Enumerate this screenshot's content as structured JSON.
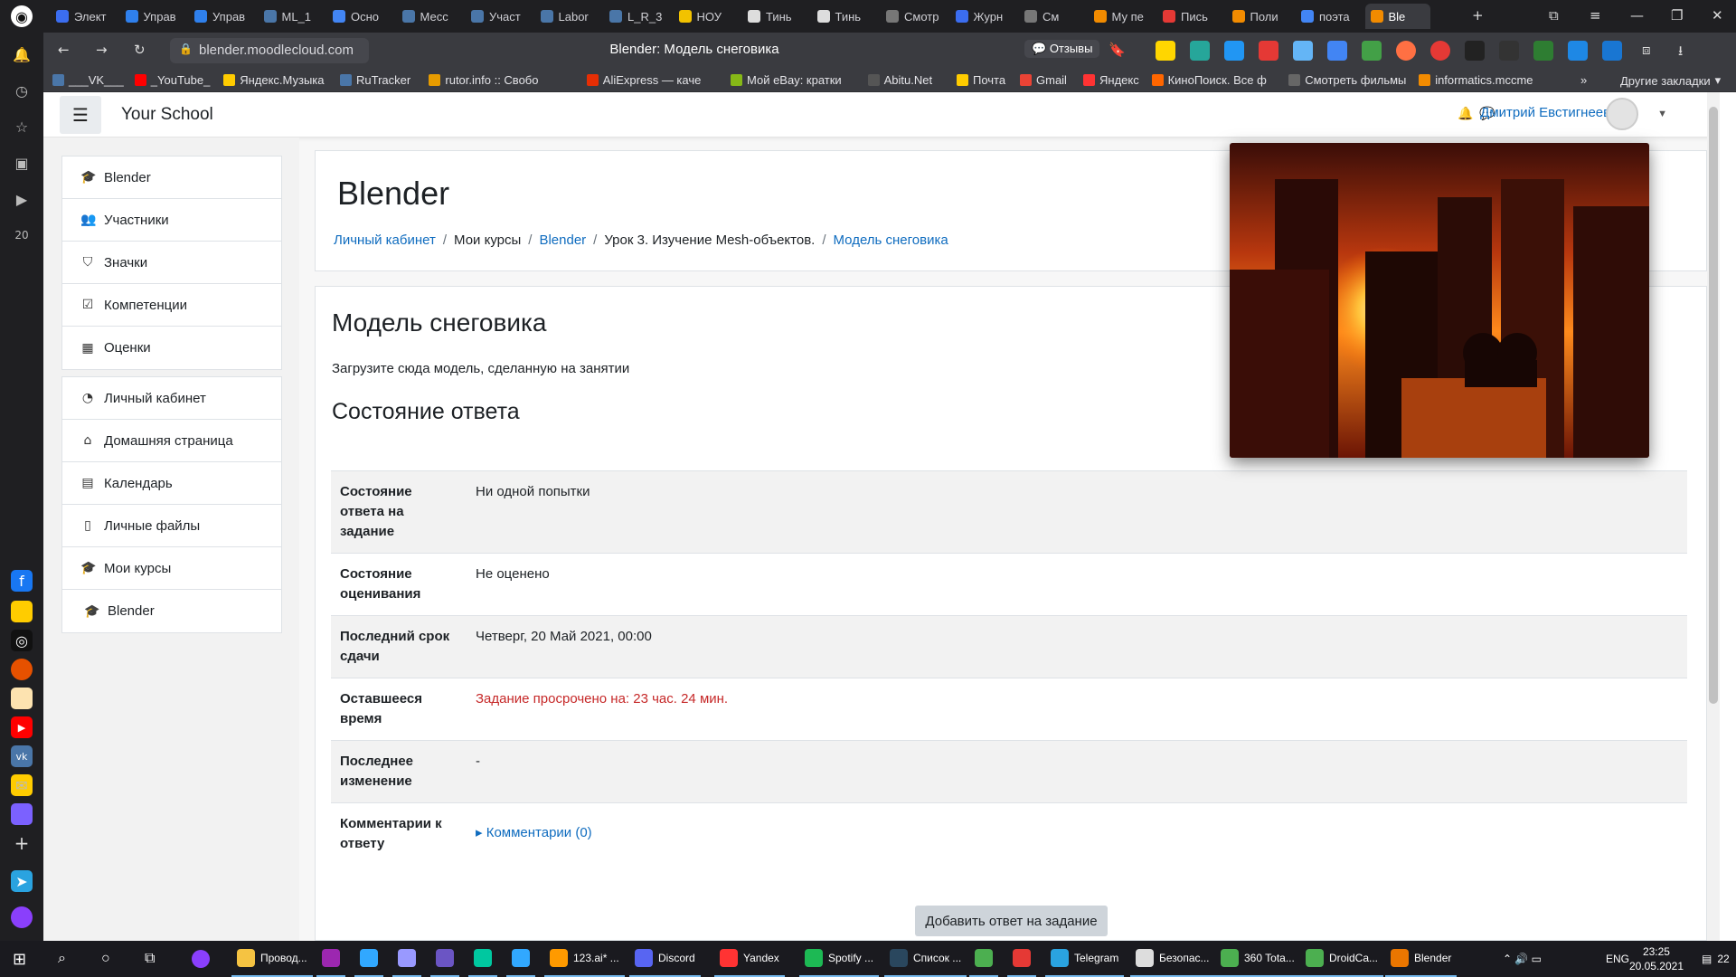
{
  "browser": {
    "tabs": [
      {
        "label": "Элект",
        "color": "#3b6df0"
      },
      {
        "label": "Управ",
        "color": "#2f80ed"
      },
      {
        "label": "Управ",
        "color": "#2f80ed"
      },
      {
        "label": "ML_1",
        "color": "#4a76a8"
      },
      {
        "label": "Осно",
        "color": "#4285f4"
      },
      {
        "label": "Месс",
        "color": "#4a76a8"
      },
      {
        "label": "Участ",
        "color": "#4a76a8"
      },
      {
        "label": "Labor",
        "color": "#4a76a8"
      },
      {
        "label": "L_R_3",
        "color": "#4a76a8"
      },
      {
        "label": "НОУ",
        "color": "#f2c200"
      },
      {
        "label": "Тинь",
        "color": "#dddddd"
      },
      {
        "label": "Тинь",
        "color": "#dddddd"
      },
      {
        "label": "Смотр",
        "color": "#777777"
      },
      {
        "label": "Журн",
        "color": "#3b6df0"
      },
      {
        "label": "См",
        "color": "#777777"
      },
      {
        "label": "Му пе",
        "color": "#f28b00"
      },
      {
        "label": "Пись",
        "color": "#e53935"
      },
      {
        "label": "Поли",
        "color": "#f28b00"
      },
      {
        "label": "поэта",
        "color": "#4285f4"
      },
      {
        "label": "Ble",
        "color": "#f28b00"
      }
    ],
    "url": "blender.moodlecloud.com",
    "page_title": "Blender: Модель снеговика",
    "feedback_label": "Отзывы",
    "bookmarks": [
      {
        "label": "___VK___",
        "color": "#4a76a8"
      },
      {
        "label": "_YouTube_",
        "color": "#ff0000"
      },
      {
        "label": "Яндекс.Музыка",
        "color": "#ffcc00"
      },
      {
        "label": "RuTracker",
        "color": "#4a76a8"
      },
      {
        "label": "rutor.info :: Свобо",
        "color": "#e69b00"
      },
      {
        "label": "AliExpress — каче",
        "color": "#e62e04"
      },
      {
        "label": "Мой eBay: кратки",
        "color": "#86b817"
      },
      {
        "label": "Abitu.Net",
        "color": "#555555"
      },
      {
        "label": "Почта",
        "color": "#ffcc00"
      },
      {
        "label": "Gmail",
        "color": "#ea4335"
      },
      {
        "label": "Яндекс",
        "color": "#ff3333"
      },
      {
        "label": "КиноПоиск. Все ф",
        "color": "#f60"
      },
      {
        "label": "Смотреть фильмы",
        "color": "#666666"
      },
      {
        "label": "informatics.mccme",
        "color": "#f28b00"
      }
    ],
    "other_bookmarks": "Другие закладки"
  },
  "moodle": {
    "site_name": "Your School",
    "user_name": "Дмитрий Евстигнеев",
    "drawer_group1": [
      {
        "label": "Blender",
        "icon": "graduation-cap-icon",
        "glyph": "🎓"
      },
      {
        "label": "Участники",
        "icon": "users-icon",
        "glyph": "👥"
      },
      {
        "label": "Значки",
        "icon": "shield-icon",
        "glyph": "⛉"
      },
      {
        "label": "Компетенции",
        "icon": "check-square-icon",
        "glyph": "☑"
      },
      {
        "label": "Оценки",
        "icon": "table-icon",
        "glyph": "▦"
      }
    ],
    "drawer_group2": [
      {
        "label": "Личный кабинет",
        "icon": "dashboard-icon",
        "glyph": "◔"
      },
      {
        "label": "Домашняя страница",
        "icon": "home-icon",
        "glyph": "⌂"
      },
      {
        "label": "Календарь",
        "icon": "calendar-icon",
        "glyph": "▤"
      },
      {
        "label": "Личные файлы",
        "icon": "file-icon",
        "glyph": "▯"
      },
      {
        "label": "Мои курсы",
        "icon": "graduation-cap-icon",
        "glyph": "🎓"
      },
      {
        "label": "Blender",
        "icon": "graduation-cap-icon",
        "glyph": "🎓"
      }
    ],
    "course_title": "Blender",
    "breadcrumbs": [
      {
        "label": "Личный кабинет",
        "link": true
      },
      {
        "label": "Мои курсы",
        "link": false
      },
      {
        "label": "Blender",
        "link": true
      },
      {
        "label": "Урок 3. Изучение Mesh-объектов.",
        "link": false
      },
      {
        "label": "Модель снеговика",
        "link": true
      }
    ],
    "assignment_title": "Модель снеговика",
    "assignment_intro": "Загрузите сюда модель, сделанную на занятии",
    "submission_heading": "Состояние ответа",
    "status_rows": [
      {
        "label": "Состояние ответа на задание",
        "value": "Ни одной попытки"
      },
      {
        "label": "Состояние оценивания",
        "value": "Не оценено"
      },
      {
        "label": "Последний срок сдачи",
        "value": "Четверг, 20 Май 2021, 00:00"
      },
      {
        "label": "Оставшееся время",
        "value": "Задание просрочено на: 23 час. 24 мин."
      },
      {
        "label": "Последнее изменение",
        "value": "-"
      },
      {
        "label": "Комментарии к ответу",
        "value": "Комментарии (0)"
      }
    ],
    "add_submission_button": "Добавить ответ на задание"
  },
  "taskbar": {
    "items": [
      {
        "label": "Провод...",
        "color": "#f5c342"
      },
      {
        "label": "",
        "color": "#9c27b0"
      },
      {
        "label": "",
        "color": "#31a8ff"
      },
      {
        "label": "",
        "color": "#9999ff"
      },
      {
        "label": "",
        "color": "#6b55c4"
      },
      {
        "label": "",
        "color": "#00c8a0"
      },
      {
        "label": "",
        "color": "#31a8ff"
      },
      {
        "label": "123.ai* ...",
        "color": "#ff9a00"
      },
      {
        "label": "Discord",
        "color": "#5865f2"
      },
      {
        "label": "Yandex",
        "color": "#ff3333"
      },
      {
        "label": "Spotify ...",
        "color": "#1db954"
      },
      {
        "label": "Список ...",
        "color": "#2a475e"
      },
      {
        "label": "",
        "color": "#4caf50"
      },
      {
        "label": "",
        "color": "#e53935"
      },
      {
        "label": "Telegram",
        "color": "#2aa3e0"
      },
      {
        "label": "Безопас...",
        "color": "#dddddd"
      },
      {
        "label": "360 Tota...",
        "color": "#4caf50"
      },
      {
        "label": "DroidCa...",
        "color": "#4caf50"
      },
      {
        "label": "Blender",
        "color": "#ea7600"
      }
    ],
    "lang": "ENG",
    "time": "23:25",
    "date": "20.05.2021",
    "notif_count": "22"
  }
}
